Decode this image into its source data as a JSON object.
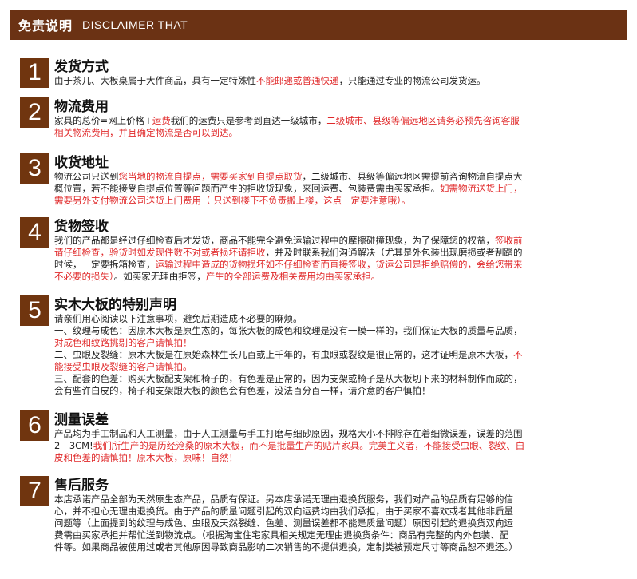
{
  "header": {
    "title_cn": "免责说明",
    "title_en": "DISCLAIMER THAT"
  },
  "sections": [
    {
      "num": "1",
      "title": "发货方式",
      "lines": [
        [
          {
            "t": "由于茶几、大板桌属于大件商品，具有一定特殊性"
          },
          {
            "t": "不能邮递或普通快递",
            "red": true
          },
          {
            "t": "，只能通过专业的物流公司发货运。"
          }
        ]
      ]
    },
    {
      "num": "2",
      "title": "物流费用",
      "lines": [
        [
          {
            "t": "家具的总价=网上价格+"
          },
          {
            "t": "运费",
            "red": true
          },
          {
            "t": "我们的运费只是参考到直达一级城市，"
          },
          {
            "t": "二级城市、县级等偏远地区请务必预先咨询客服",
            "red": true
          }
        ],
        [
          {
            "t": "相关物流费用，并且确定物流是否可以到达。",
            "red": true
          }
        ]
      ]
    },
    {
      "num": "3",
      "title": "收货地址",
      "lines": [
        [
          {
            "t": "物流公司只送到"
          },
          {
            "t": "您当地的物流自提点，需要买家到自提点取货",
            "red": true
          },
          {
            "t": "，二级城市、县级等偏远地区需提前咨询物流自提点大"
          }
        ],
        [
          {
            "t": "概位置，若不能接受自提点位置等问题而产生的拒收货现象，来回运费、包装费需由买家承担。"
          },
          {
            "t": "如需物流送货上门，",
            "red": true
          }
        ],
        [
          {
            "t": "需要另外支付物流公司送货上门费用（  只送到楼下不负责搬上楼，这点一定要注意哦）。",
            "red": true
          }
        ]
      ]
    },
    {
      "num": "4",
      "title": "货物签收",
      "lines": [
        [
          {
            "t": "我们的产品都是经过仔细检查后才发货，商品不能完全避免运输过程中的摩擦碰撞现象，为了保障您的权益，"
          },
          {
            "t": "签收前",
            "red": true
          }
        ],
        [
          {
            "t": "请仔细检查，验货时如发现件数不对或者损坏请拒收",
            "red": true
          },
          {
            "t": "，并及时联系我们沟通解决（尤其是外包装出现磨损或者刮蹭的"
          }
        ],
        [
          {
            "t": "时候，一定要拆箱检查，"
          },
          {
            "t": "运输过程中造成的货物损坏如不仔细检查而直接签收，货运公司是拒绝赔偿的，会给您带来",
            "red": true
          }
        ],
        [
          {
            "t": "不必要的损失）",
            "red": true
          },
          {
            "t": "。如买家无理由拒签，"
          },
          {
            "t": "产生的全部运费及相关费用均由买家承担。",
            "red": true
          }
        ]
      ]
    },
    {
      "num": "5",
      "title": "实木大板的特别声明",
      "lines": [
        [
          {
            "t": "请亲们用心阅读以下注意事项，避免后期造成不必要的麻烦。"
          }
        ],
        [
          {
            "t": "一、纹理与成色：因原木大板是原生态的，每张大板的成色和纹理是没有一模一样的，我们保证大板的质量与品质，"
          }
        ],
        [
          {
            "t": "对成色和纹路挑剔的客户请慎拍！",
            "red": true
          }
        ],
        [
          {
            "t": "二、虫眼及裂缝：原木大板是在原始森林生长几百或上千年的，有虫眼或裂纹是很正常的，这才证明是原木大板，"
          },
          {
            "t": "不",
            "red": true
          }
        ],
        [
          {
            "t": "能接受虫眼及裂缝的客户请慎拍。",
            "red": true
          }
        ],
        [
          {
            "t": "三、配套的色差：购买大板配支架和椅子的，有色差是正常的，因为支架或椅子是从大板切下来的材料制作而成的，"
          }
        ],
        [
          {
            "t": "会有些许白皮的，椅子和支架跟大板的颜色会有色差，没法百分百一样，请介意的客户慎拍！"
          }
        ]
      ]
    },
    {
      "num": "6",
      "title": "测量误差",
      "lines": [
        [
          {
            "t": "产品均为手工制品和人工测量，由于人工测量与手工打磨与细砂原因，规格大小不排除存在着细微误差，误差的范围"
          }
        ],
        [
          {
            "t": "2—3CM!"
          },
          {
            "t": "我们所生产的是历经沧桑的原木大板，而不是批量生产的贴片家具。完美主义者，不能接受虫眼、裂纹、白",
            "red": true
          }
        ],
        [
          {
            "t": "皮和色差的请慎拍！原木大板，原味！自然！",
            "red": true
          }
        ]
      ]
    },
    {
      "num": "7",
      "title": "售后服务",
      "lines": [
        [
          {
            "t": "本店承诺产品全部为天然原生态产品，品质有保证。另本店承诺无理由退换货服务，我们对产品的品质有足够的信"
          }
        ],
        [
          {
            "t": "心，并不担心无理由退换货。由于产品的质量问题引起的双向运费均由我们承担，由于买家不喜欢或者其他非质量"
          }
        ],
        [
          {
            "t": "问题等（上面提到的纹理与成色、虫眼及天然裂缝、色差、测量误差都不能是质量问题）原因引起的退换货双向运"
          }
        ],
        [
          {
            "t": "费需由买家承担并帮忙送到物流点。（根据淘宝住宅家具相关规定无理由退换货条件：商品有完整的内外包装、配"
          }
        ],
        [
          {
            "t": "件等。如果商品被使用过或者其他原因导致商品影响二次销售的不提供退换，定制类被预定尺寸等商品恕不退还。）"
          }
        ]
      ]
    }
  ]
}
